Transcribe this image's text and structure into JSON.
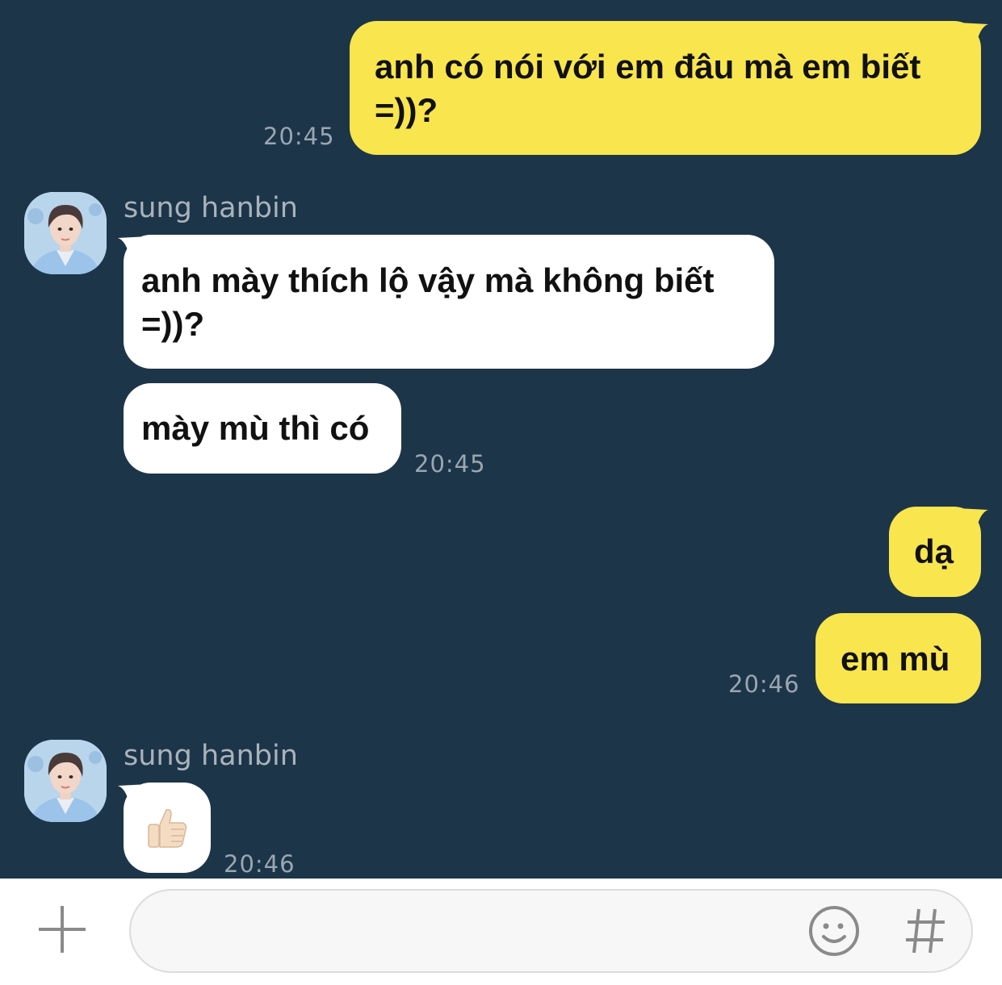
{
  "messages": [
    {
      "direction": "outgoing",
      "lines": [
        "anh có nói với em đâu mà em biết",
        "=))?"
      ],
      "time": "20:45"
    },
    {
      "direction": "incoming",
      "sender": "sung hanbin",
      "lines": [
        "anh mày thích lộ vậy mà không biết",
        "=))?"
      ]
    },
    {
      "direction": "incoming",
      "lines": [
        "mày mù thì có"
      ],
      "time": "20:45"
    },
    {
      "direction": "outgoing",
      "lines": [
        "dạ"
      ]
    },
    {
      "direction": "outgoing",
      "lines": [
        "em mù"
      ],
      "time": "20:46"
    },
    {
      "direction": "incoming",
      "sender": "sung hanbin",
      "sticker": "thumbs-up",
      "time": "20:46"
    }
  ],
  "composer": {
    "input_value": "",
    "add_icon": "plus-icon",
    "emoji_icon": "smiley-icon",
    "hashtag_icon": "hashtag-icon"
  },
  "colors": {
    "background": "#1d3549",
    "outgoing_bubble": "#f9e54e",
    "incoming_bubble": "#ffffff",
    "timestamp": "#9aa6b1"
  }
}
